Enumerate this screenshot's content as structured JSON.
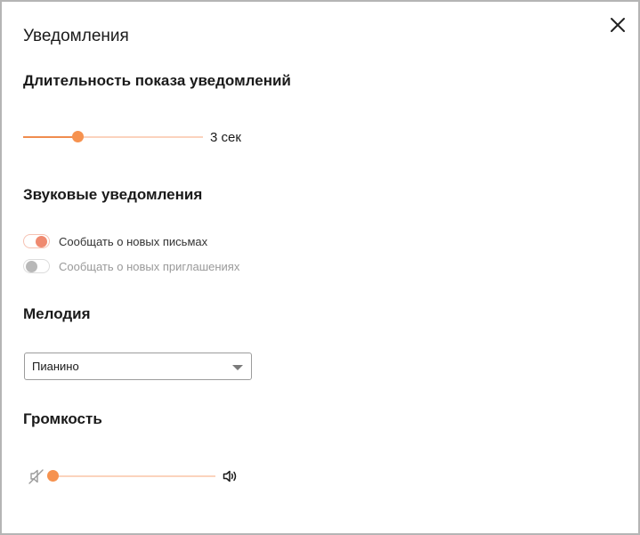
{
  "dialog": {
    "title": "Уведомления",
    "close_icon": "close-icon"
  },
  "duration": {
    "heading": "Длительность показа уведомлений",
    "value_label": "3 сек",
    "level_fraction": 0.3
  },
  "sound": {
    "heading": "Звуковые уведомления",
    "toggles": [
      {
        "label": "Сообщать о новых письмах",
        "on": true
      },
      {
        "label": "Сообщать о новых приглашениях",
        "on": false
      }
    ]
  },
  "melody": {
    "heading": "Мелодия",
    "selected": "Пианино"
  },
  "volume": {
    "heading": "Громкость",
    "level_fraction": 0.0,
    "mute_icon": "volume-mute-icon",
    "loud_icon": "volume-up-icon"
  },
  "colors": {
    "accent": "#f6924f",
    "track": "#fbd3bd",
    "toggle_on": "#ef8a70",
    "toggle_off": "#b8b8b8"
  }
}
